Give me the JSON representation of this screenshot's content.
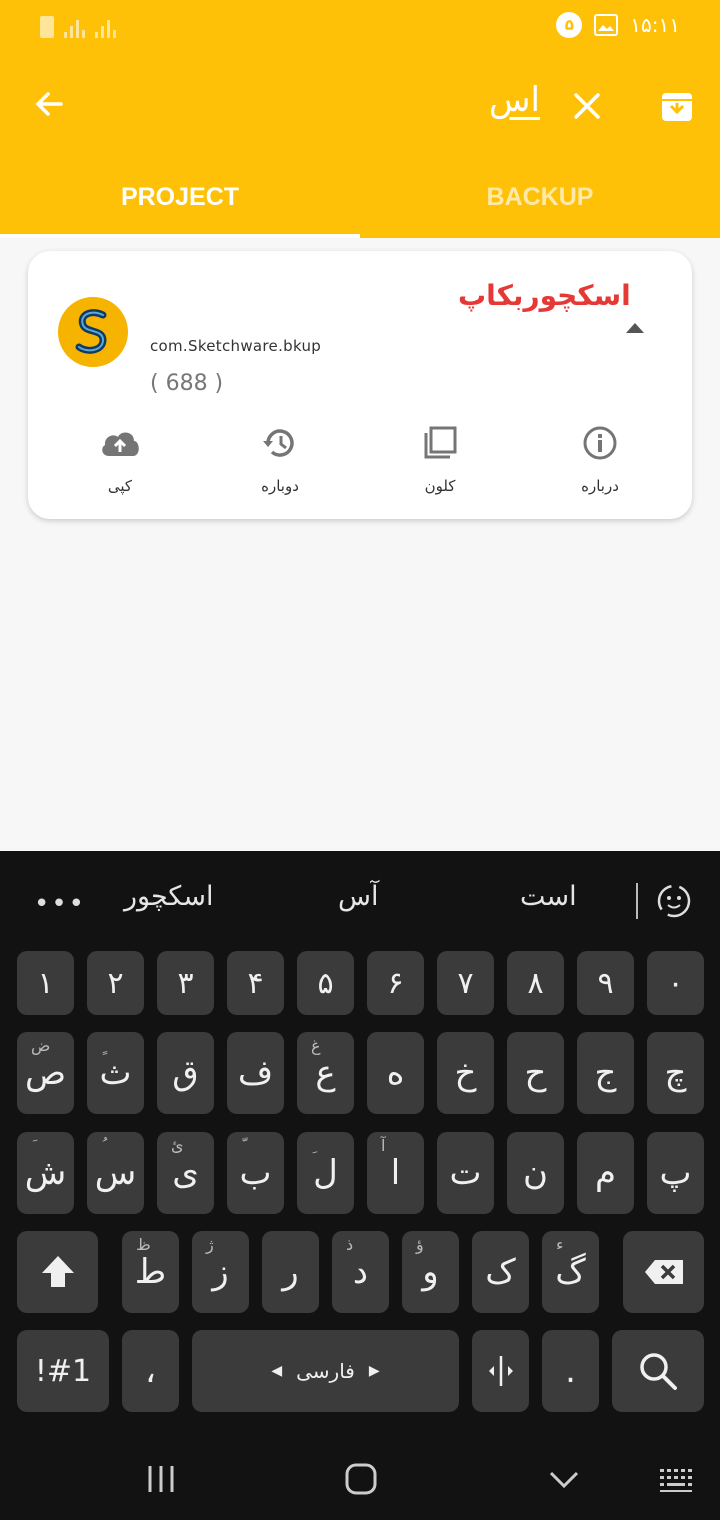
{
  "status_bar": {
    "time": "۱۵:۱۱",
    "badge": "۵"
  },
  "search": {
    "query": "اس"
  },
  "tabs": [
    {
      "label": "PROJECT"
    },
    {
      "label": "BACKUP"
    }
  ],
  "card": {
    "title": "اسکچوربکاپ",
    "package": "com.Sketchware.bkup",
    "count": "( 688 )",
    "actions": [
      {
        "label": "کپی",
        "icon": "cloud-upload-icon"
      },
      {
        "label": "دوباره",
        "icon": "history-icon"
      },
      {
        "label": "کلون",
        "icon": "copy-icon"
      },
      {
        "label": "درباره",
        "icon": "info-icon"
      }
    ]
  },
  "keyboard": {
    "suggestions": [
      "اسکچور",
      "آس",
      "است"
    ],
    "row_numbers": [
      "۱",
      "۲",
      "۳",
      "۴",
      "۵",
      "۶",
      "۷",
      "۸",
      "۹",
      "۰"
    ],
    "row1": [
      {
        "main": "ص",
        "alt": "ض"
      },
      {
        "main": "ث",
        "alt": "ٍ"
      },
      {
        "main": "ق",
        "alt": ""
      },
      {
        "main": "ف",
        "alt": ""
      },
      {
        "main": "ع",
        "alt": "غ"
      },
      {
        "main": "ه",
        "alt": ""
      },
      {
        "main": "خ",
        "alt": ""
      },
      {
        "main": "ح",
        "alt": ""
      },
      {
        "main": "ج",
        "alt": ""
      },
      {
        "main": "چ",
        "alt": ""
      }
    ],
    "row2": [
      {
        "main": "ش",
        "alt": "َ"
      },
      {
        "main": "س",
        "alt": "ُ"
      },
      {
        "main": "ی",
        "alt": "ئ"
      },
      {
        "main": "ب",
        "alt": "ّ"
      },
      {
        "main": "ل",
        "alt": "ِ"
      },
      {
        "main": "ا",
        "alt": "آ"
      },
      {
        "main": "ت",
        "alt": ""
      },
      {
        "main": "ن",
        "alt": ""
      },
      {
        "main": "م",
        "alt": ""
      },
      {
        "main": "پ",
        "alt": ""
      }
    ],
    "row3": [
      {
        "main": "ط",
        "alt": "ظ"
      },
      {
        "main": "ز",
        "alt": "ژ"
      },
      {
        "main": "ر",
        "alt": ""
      },
      {
        "main": "د",
        "alt": "ذ"
      },
      {
        "main": "و",
        "alt": "ؤ"
      },
      {
        "main": "ک",
        "alt": ""
      },
      {
        "main": "گ",
        "alt": "ء"
      }
    ],
    "symbols_label": "!#1",
    "comma": "،",
    "space_label": "فارسی",
    "period": "."
  }
}
